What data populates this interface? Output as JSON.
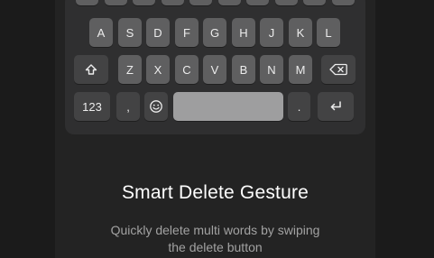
{
  "keyboard": {
    "row2": [
      "A",
      "S",
      "D",
      "F",
      "G",
      "H",
      "J",
      "K",
      "L"
    ],
    "row3": [
      "Z",
      "X",
      "C",
      "V",
      "B",
      "N",
      "M"
    ],
    "numbers_label": "123",
    "comma_label": ",",
    "period_label": ".",
    "icons": {
      "shift": "shift-icon",
      "backspace": "backspace-icon",
      "emoji": "emoji-icon",
      "return": "return-icon"
    }
  },
  "feature": {
    "title": "Smart Delete Gesture",
    "description_line1": "Quickly delete multi words by swiping",
    "description_line2": "the delete button"
  },
  "colors": {
    "background": "#1b1b1b",
    "panel": "#232323",
    "keyboard": "#2f2f30",
    "key": "#5f5f60",
    "key_dark": "#434344"
  }
}
